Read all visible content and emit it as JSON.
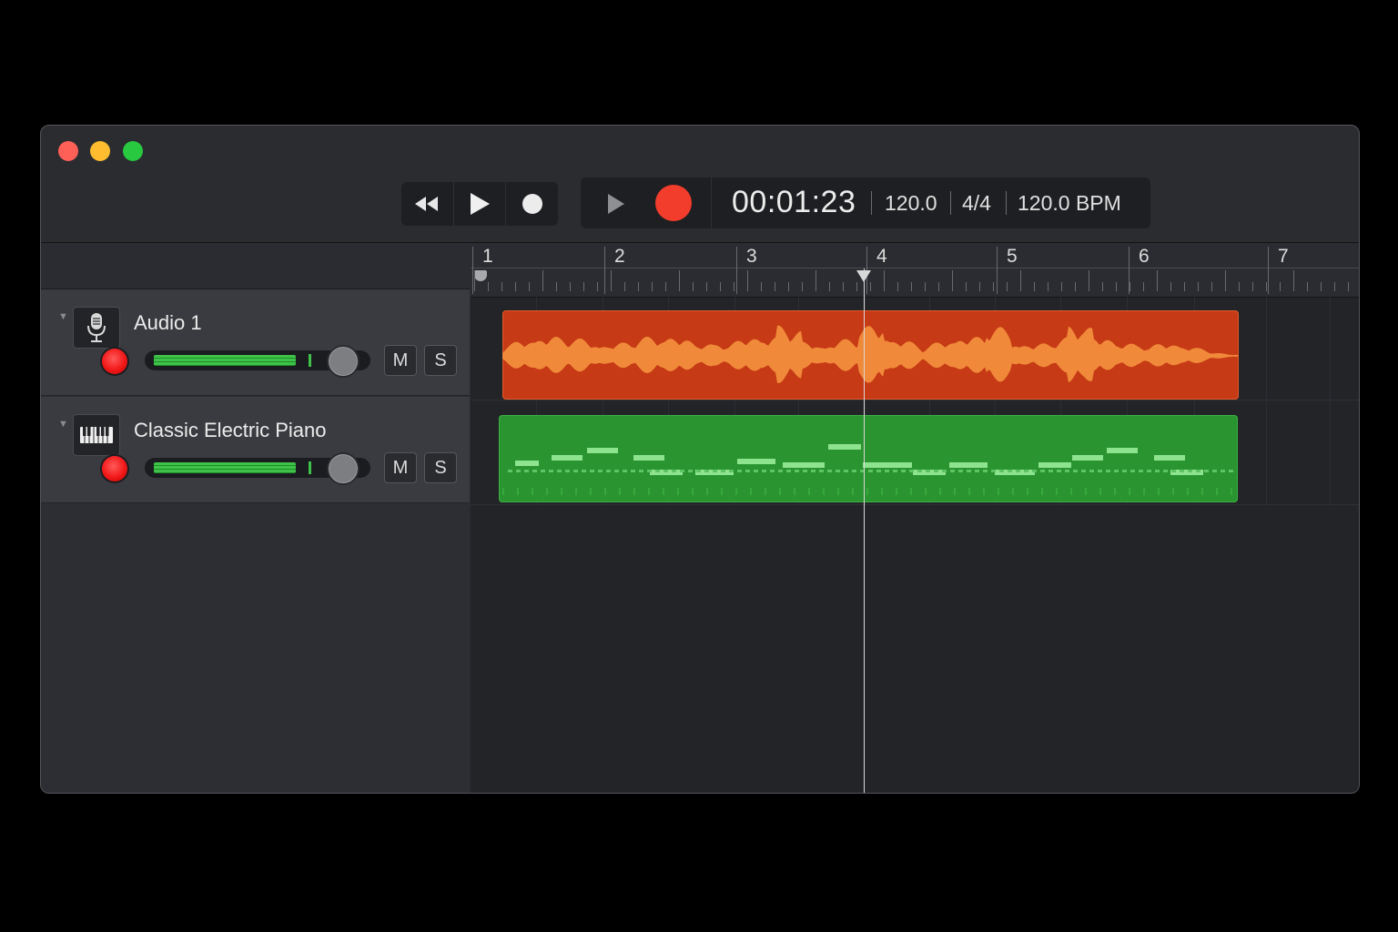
{
  "transport": {
    "buttons": [
      {
        "name": "rewind-icon"
      },
      {
        "name": "play-icon"
      },
      {
        "name": "record-dot-icon"
      }
    ]
  },
  "lcd": {
    "time": "00:01:23",
    "tempo": "120.0",
    "signature": "4/4",
    "bpm": "120.0 BPM"
  },
  "ruler": {
    "bars": [
      "1",
      "2",
      "3",
      "4",
      "5",
      "6",
      "7"
    ]
  },
  "playhead": {
    "bar": 4
  },
  "tracks": [
    {
      "name": "Audio 1",
      "icon": "microphone-icon",
      "mute": "M",
      "solo": "S",
      "region_color": "#c63a15"
    },
    {
      "name": "Classic Electric Piano",
      "icon": "piano-keyboard-icon",
      "mute": "M",
      "solo": "S",
      "region_color": "#2a9430"
    }
  ],
  "colors": {
    "record": "#f23c2c",
    "audio_region": "#c63a15",
    "midi_region": "#2a9430",
    "meter": "#3fc24a"
  }
}
